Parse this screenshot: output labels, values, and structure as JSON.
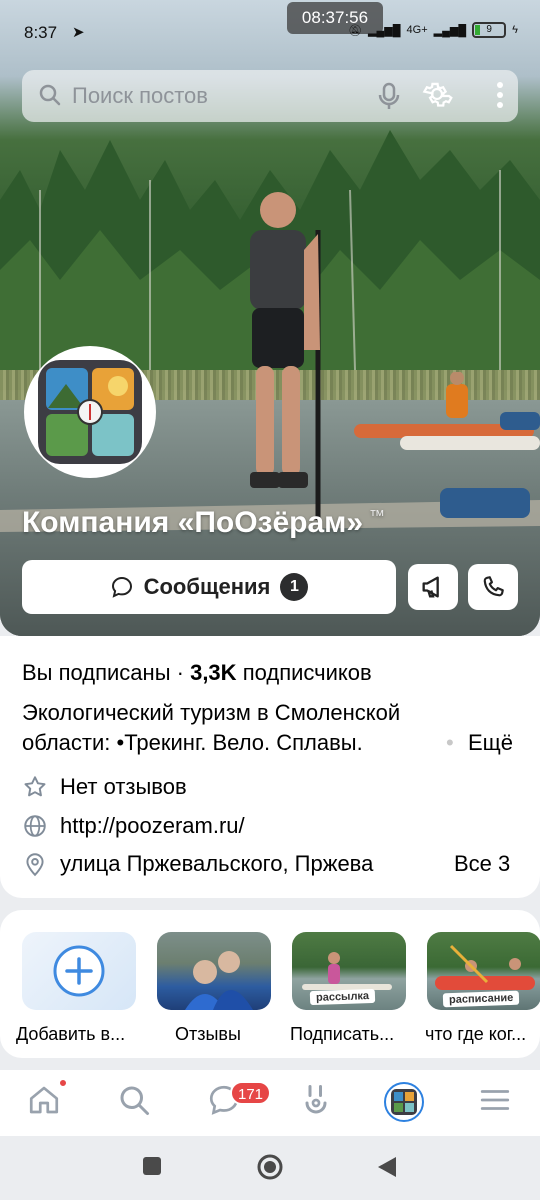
{
  "status_bar": {
    "time": "8:37",
    "clock_overlay": "08:37:56",
    "network": "4G+",
    "battery": "9"
  },
  "search": {
    "placeholder": "Поиск постов"
  },
  "profile": {
    "name": "Компания «ПоОзёрам»",
    "trademark": "™",
    "messages_label": "Сообщения",
    "messages_count": "1"
  },
  "info": {
    "subscribed": "Вы подписаны",
    "separator": "·",
    "subscribers_count": "3,3K",
    "subscribers_label": "подписчиков",
    "description_line1": "Экологический туризм в Смоленской",
    "description_line2": "области: •Трекинг. Вело. Сплавы.",
    "more": "Ещё",
    "reviews": "Нет отзывов",
    "website": "http://poozeram.ru/",
    "address": "улица Пржевальского, Пржева",
    "address_all": "Все 3"
  },
  "stories": [
    {
      "label": "Добавить в...",
      "overlay": ""
    },
    {
      "label": "Отзывы",
      "overlay": ""
    },
    {
      "label": "Подписать...",
      "overlay": "рассылка"
    },
    {
      "label": "что где ког...",
      "overlay": "расписание"
    }
  ],
  "tabbar": {
    "messages_badge": "171"
  },
  "colors": {
    "accent": "#2d81e0",
    "badge_red": "#e64646",
    "dark_badge": "#2c2d2e"
  }
}
